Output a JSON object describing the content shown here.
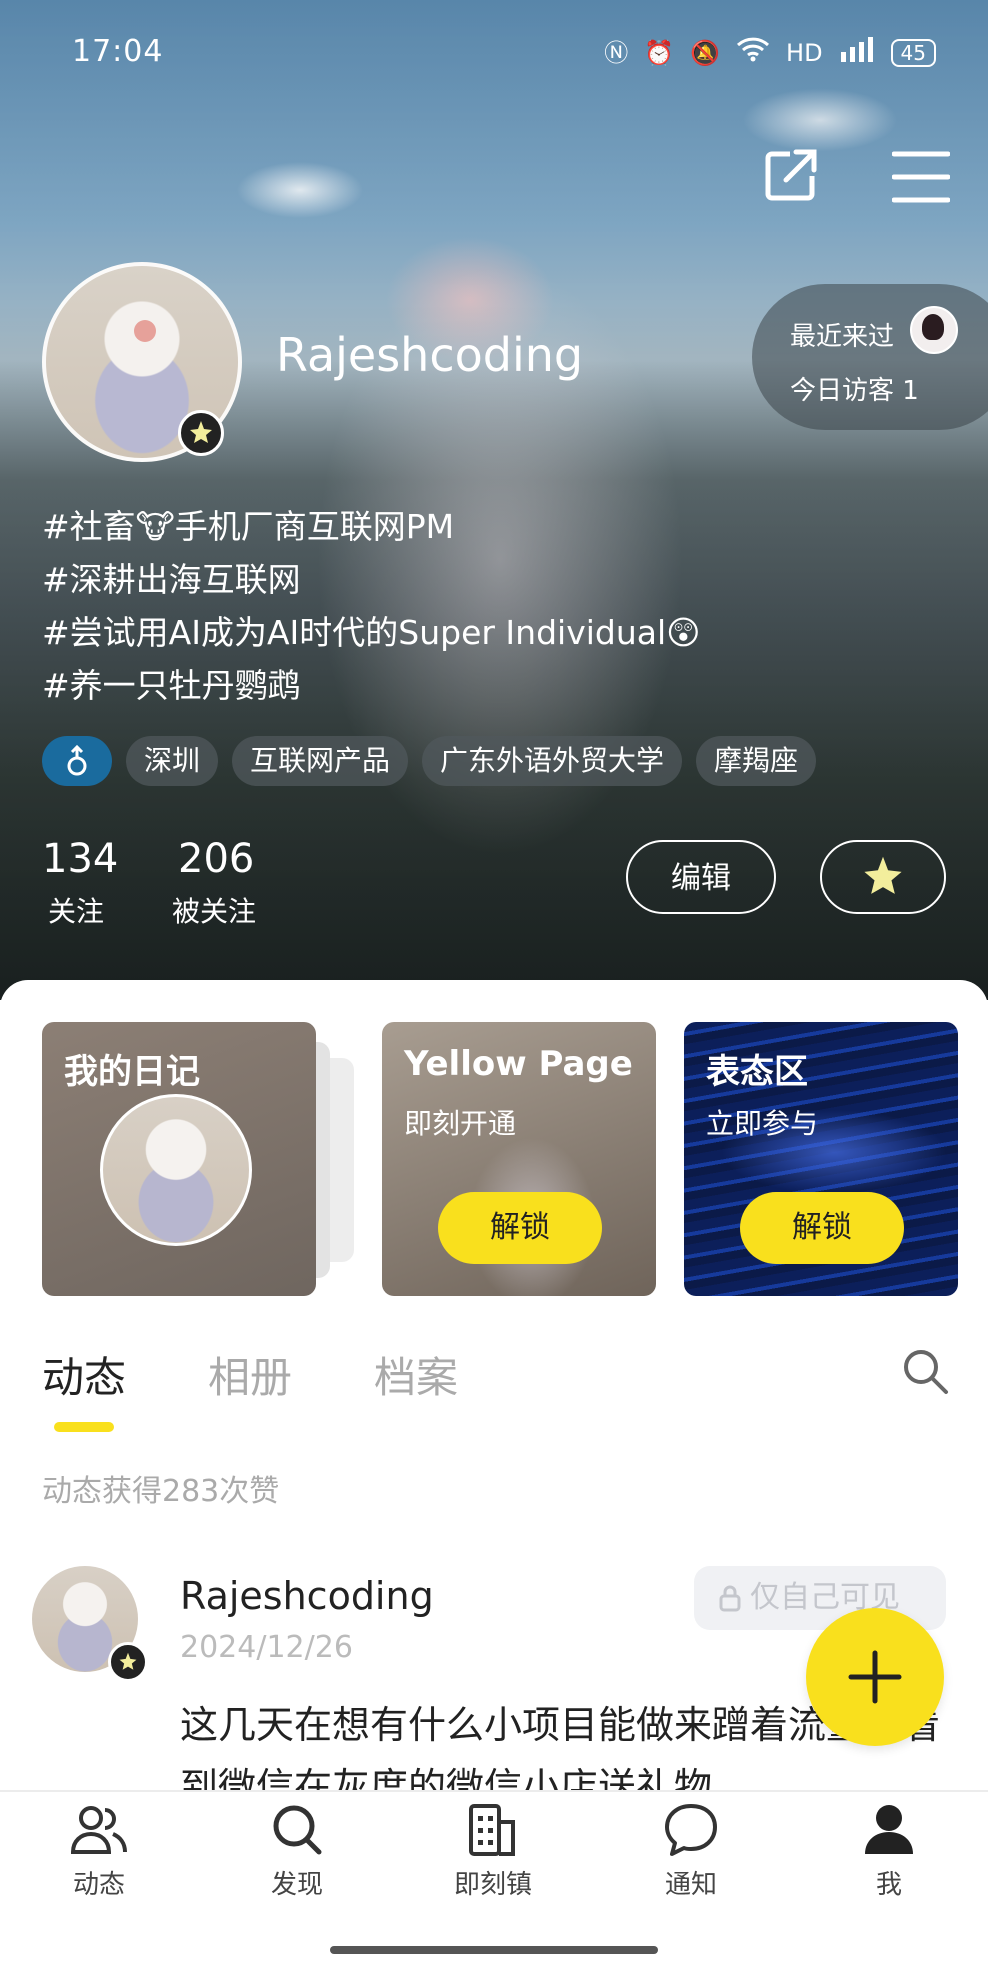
{
  "status_bar": {
    "time": "17:04",
    "battery": "45"
  },
  "profile": {
    "username": "Rajeshcoding",
    "recent_visit_label": "最近来过",
    "today_visitors": "今日访客 1",
    "bio": [
      "#社畜🐮手机厂商互联网PM",
      "#深耕出海互联网",
      "#尝试用AI成为AI时代的Super Individual😲",
      "#养一只牡丹鹦鹉"
    ],
    "tags": [
      "深圳",
      "互联网产品",
      "广东外语外贸大学",
      "摩羯座"
    ],
    "following_count": "134",
    "following_label": "关注",
    "followers_count": "206",
    "followers_label": "被关注",
    "edit_label": "编辑"
  },
  "cards": {
    "diary_title": "我的日记",
    "yellow_page_title": "Yellow Page",
    "yellow_page_sub": "即刻开通",
    "express_title": "表态区",
    "express_sub": "立即参与",
    "unlock_label": "解锁"
  },
  "tabs": [
    "动态",
    "相册",
    "档案"
  ],
  "likes_summary": "动态获得283次赞",
  "post": {
    "author": "Rajeshcoding",
    "date": "2024/12/26",
    "visibility": "仅自己可见",
    "text": "这几天在想有什么小项目能做来蹭着流量，看到微信在灰度的微信小店送礼物"
  },
  "bottom_nav": [
    {
      "label": "动态",
      "icon": "people-icon"
    },
    {
      "label": "发现",
      "icon": "search-icon"
    },
    {
      "label": "即刻镇",
      "icon": "building-icon"
    },
    {
      "label": "通知",
      "icon": "chat-bubble-icon"
    },
    {
      "label": "我",
      "icon": "person-icon"
    }
  ],
  "colors": {
    "accent": "#f9e01d",
    "gender_tag": "#1a6b9e"
  }
}
